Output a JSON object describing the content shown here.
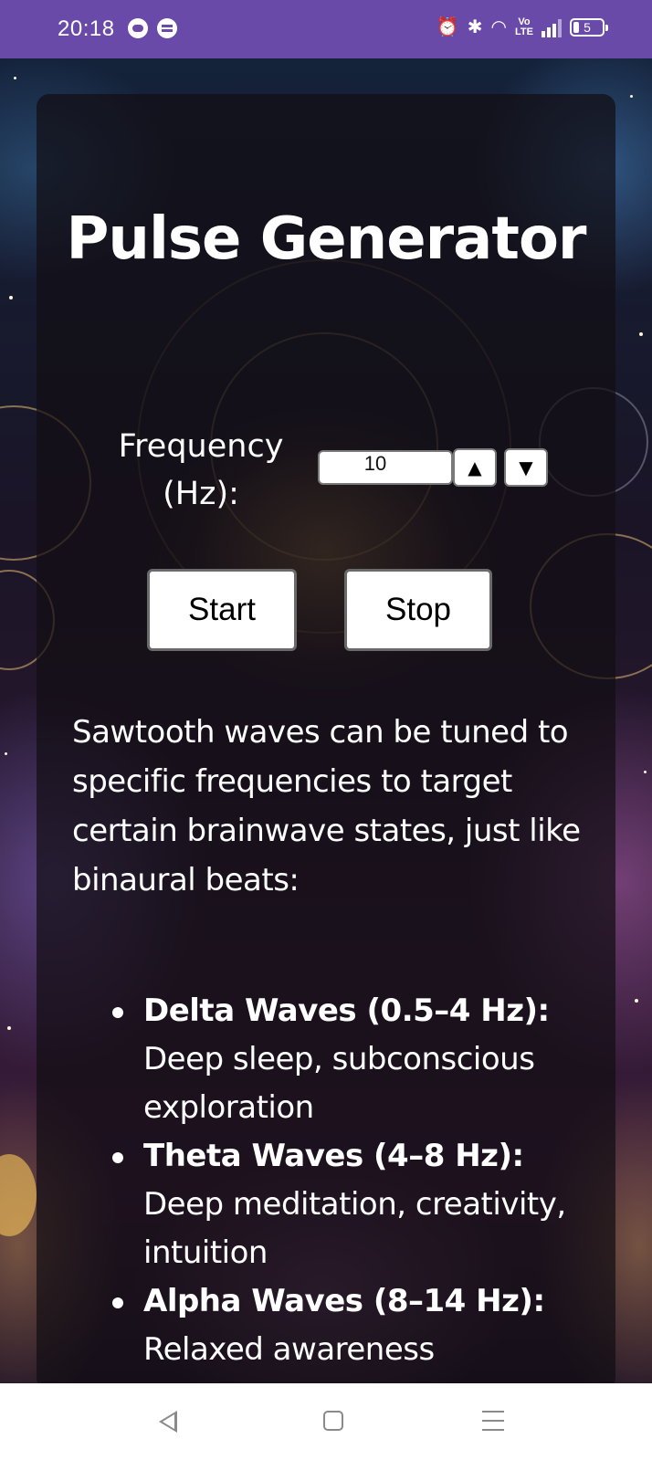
{
  "status_bar": {
    "time": "20:18",
    "left_icons": [
      "robot-notification-icon",
      "messaging-notification-icon"
    ],
    "right_icons": [
      "alarm-icon",
      "bluetooth-icon",
      "wifi-icon",
      "volte-icon",
      "signal-icon",
      "battery-icon"
    ],
    "volte_label": "Vo\nLTE",
    "battery_level": "5"
  },
  "app": {
    "title": "Pulse Generator",
    "frequency": {
      "label": "Frequency (Hz):",
      "value": "10",
      "up_symbol": "▲",
      "down_symbol": "▼"
    },
    "buttons": {
      "start": "Start",
      "stop": "Stop"
    },
    "intro": "Sawtooth waves can be tuned to specific frequencies to target certain brainwave states, just like binaural beats:",
    "waves": [
      {
        "name": "Delta Waves (0.5–4 Hz):",
        "description": "Deep sleep, subconscious exploration"
      },
      {
        "name": "Theta Waves (4–8 Hz):",
        "description": "Deep meditation, creativity, intuition"
      },
      {
        "name": "Alpha Waves (8–14 Hz):",
        "description": "Relaxed awareness"
      }
    ]
  },
  "nav_bar": {
    "buttons": [
      "back-icon",
      "home-icon",
      "recents-icon"
    ]
  }
}
